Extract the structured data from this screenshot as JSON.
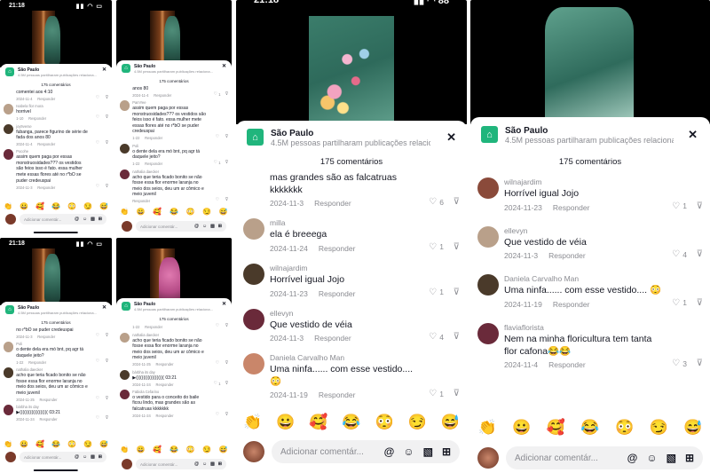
{
  "status": {
    "time_a": "21:18",
    "time_b": "21:18",
    "time_c": "21:18",
    "time_d": "21:18",
    "battery": "88"
  },
  "banner": {
    "title": "São Paulo",
    "subtitle_small": "4.5M pessoas partilharam publicações relaciona...",
    "subtitle": "4.5M pessoas partilharam publicações relaciona...",
    "close": "✕"
  },
  "comments_count": "175 comentários",
  "reply_label": "Responder",
  "input_placeholder": "Adicionar comentár...",
  "input_tools": [
    "@",
    "☺",
    "▧",
    "⊞"
  ],
  "emojis": [
    "👏",
    "😀",
    "🥰",
    "😂",
    "😳",
    "😏",
    "😅"
  ],
  "small_a": {
    "rows": [
      {
        "user": "",
        "text": "comentei aos 4:10",
        "date": "2024-11-4",
        "likes": ""
      },
      {
        "user": "Isabela flor mora",
        "text": "horrivel",
        "date": "1-10",
        "likes": ""
      },
      {
        "user": "joy9verse",
        "text": "fubanga, parece figurino de série de fada dos anos 80",
        "date": "2024-11-4",
        "likes": ""
      },
      {
        "user": "Pocohe",
        "text": "assim quem paga por essas monstruosidades??? os vestidos são feios isso é fato. essa mulher mete essas flores até no r*bO se puder credeuspai",
        "date": "2024-11-3",
        "likes": ""
      }
    ]
  },
  "small_b": {
    "rows": [
      {
        "user": "",
        "text": "anos 80",
        "date": "2024-11-4",
        "likes": "1"
      },
      {
        "user": "PamYee",
        "text": "assim quem paga por essas monstruosidades??? os vestidos são feios isso é fato. essa mulher mete essas flores até no r*bO se puder credeuspai",
        "date": "1-22",
        "likes": ""
      },
      {
        "user": "Poli",
        "text": "o dente dela era mó bnt, pq agr tá daquele jeito?",
        "date": "1-22",
        "likes": "1"
      },
      {
        "user": "nathalia daecker",
        "text": "acho que teria ficado bonito se não fosse essa flor enorme laranja no meio dos seios, deu um ar cômico e meio juvenil",
        "date": "",
        "likes": ""
      }
    ]
  },
  "small_c": {
    "rows": [
      {
        "user": "",
        "text": "no r*bO se puder credeuspai",
        "date": "2024-11-3",
        "likes": ""
      },
      {
        "user": "Poli",
        "text": "o dente dela era mó bnt, pq agr tá daquele jeito?",
        "date": "1-22",
        "likes": ""
      },
      {
        "user": "nathalia daecker",
        "text": "acho que teria ficado bonito se não fosse essa flor enorme laranja no meio dos seios, deu um ar cômico e meio juvenil",
        "date": "2024-11-25",
        "likes": ""
      },
      {
        "user": "bárbha its day",
        "text": "▶((((((((((((((((((( 03:21",
        "date": "2024-11-24",
        "likes": ""
      }
    ]
  },
  "small_d": {
    "rows": [
      {
        "user": "",
        "text": "",
        "date": "1-22",
        "likes": ""
      },
      {
        "user": "nathalia daecker",
        "text": "acho que teria ficado bonito se não fosse essa flor enorme laranja no meio dos seios, deu um ar cômico e meio juvenil",
        "date": "2024-11-25",
        "likes": ""
      },
      {
        "user": "bárbha its day",
        "text": "▶((((((((((((((((((( 03:21",
        "date": "2024-11-24",
        "likes": "1"
      },
      {
        "user": "Fabiola Cefarino",
        "text": "o vestido para o conceito do baile ficou lindo, mas grandes são as falcatruas kkkkkkk",
        "date": "2024-11-24",
        "likes": ""
      }
    ]
  },
  "large_c": {
    "rows": [
      {
        "user": "",
        "text": "mas grandes são as falcatruas kkkkkkk",
        "date": "2024-11-3",
        "likes": "6"
      },
      {
        "user": "milla",
        "text": "ela é breeega",
        "date": "2024-11-24",
        "likes": "1"
      },
      {
        "user": "wilnajardim",
        "text": "Horrível igual Jojo",
        "date": "2024-11-23",
        "likes": "1"
      },
      {
        "user": "ellevyn",
        "text": "Que vestido de véia",
        "date": "2024-11-3",
        "likes": "4"
      },
      {
        "user": "Daniela Carvalho Man",
        "text": "Uma ninfa...... com esse vestido.... 😳",
        "date": "2024-11-19",
        "likes": "1"
      }
    ]
  },
  "large_d": {
    "rows": [
      {
        "user": "wilnajardim",
        "text": "Horrível igual Jojo",
        "date": "2024-11-23",
        "likes": "1"
      },
      {
        "user": "ellevyn",
        "text": "Que vestido de véia",
        "date": "2024-11-3",
        "likes": "4"
      },
      {
        "user": "Daniela Carvalho Man",
        "text": "Uma ninfa...... com esse vestido.... 😳",
        "date": "2024-11-19",
        "likes": "1"
      },
      {
        "user": "flaviaflorista",
        "text": "Nem na minha floricultura tem tanta flor cafona😂😂",
        "date": "2024-11-4",
        "likes": "3"
      }
    ]
  }
}
